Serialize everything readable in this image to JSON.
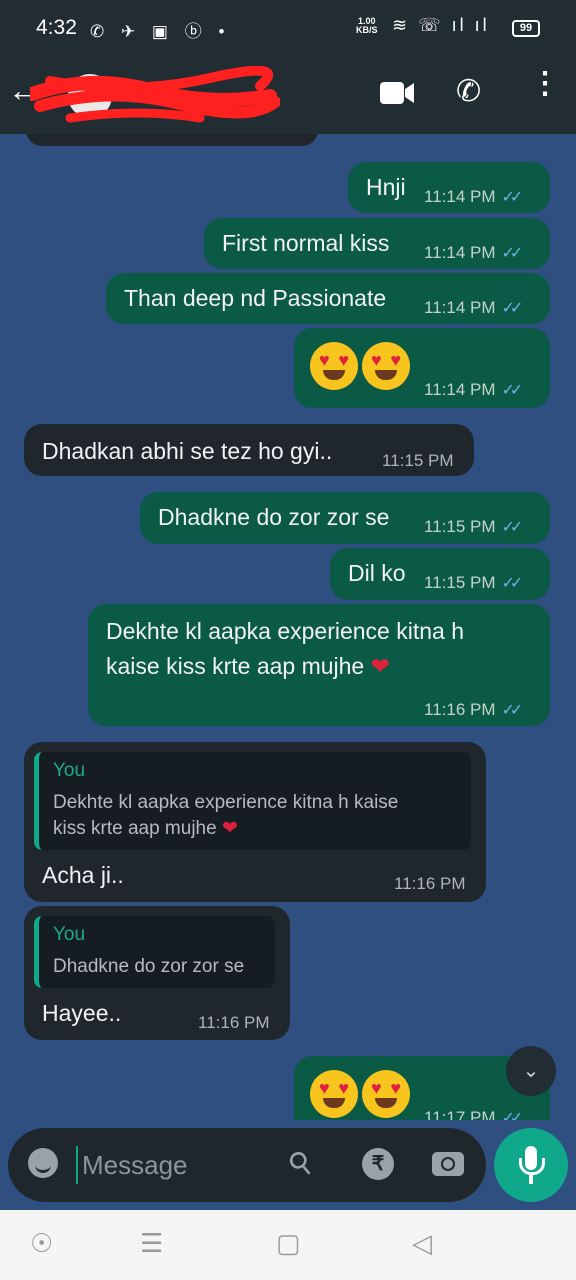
{
  "status_bar": {
    "time": "4:32",
    "speed_value": "1.00",
    "speed_unit": "KB/S",
    "battery": "99"
  },
  "header": {
    "contact_name": ""
  },
  "messages": [
    {
      "text": "Hnji",
      "time": "11:14 PM"
    },
    {
      "text": "First normal kiss",
      "time": "11:14 PM"
    },
    {
      "text": "Than deep nd Passionate",
      "time": "11:14 PM"
    },
    {
      "text": "😍😍",
      "time": "11:14 PM"
    },
    {
      "text": "Dhadkan abhi se tez ho gyi..",
      "time": "11:15 PM"
    },
    {
      "text": "Dhadkne do zor zor se",
      "time": "11:15 PM"
    },
    {
      "text": "Dil ko",
      "time": "11:15 PM"
    },
    {
      "line1": "Dekhte kl aapka experience kitna h",
      "line2": "kaise kiss krte aap mujhe",
      "time": "11:16 PM"
    },
    {
      "quote_name": "You",
      "quote_line1": "Dekhte kl aapka experience kitna h kaise",
      "quote_line2": "kiss krte aap mujhe",
      "text": "Acha ji..",
      "time": "11:16 PM"
    },
    {
      "quote_name": "You",
      "quote_text": "Dhadkne do zor zor se",
      "text": "Hayee..",
      "time": "11:16 PM"
    },
    {
      "text": "😍😍",
      "time": "11:17 PM"
    }
  ],
  "composer": {
    "placeholder": "Message"
  },
  "colors": {
    "chat_bg": "#2f4f80",
    "outgoing": "#0a5a45",
    "incoming": "#1f272d",
    "accent": "#10a88b",
    "read_tick": "#65b7e8"
  }
}
